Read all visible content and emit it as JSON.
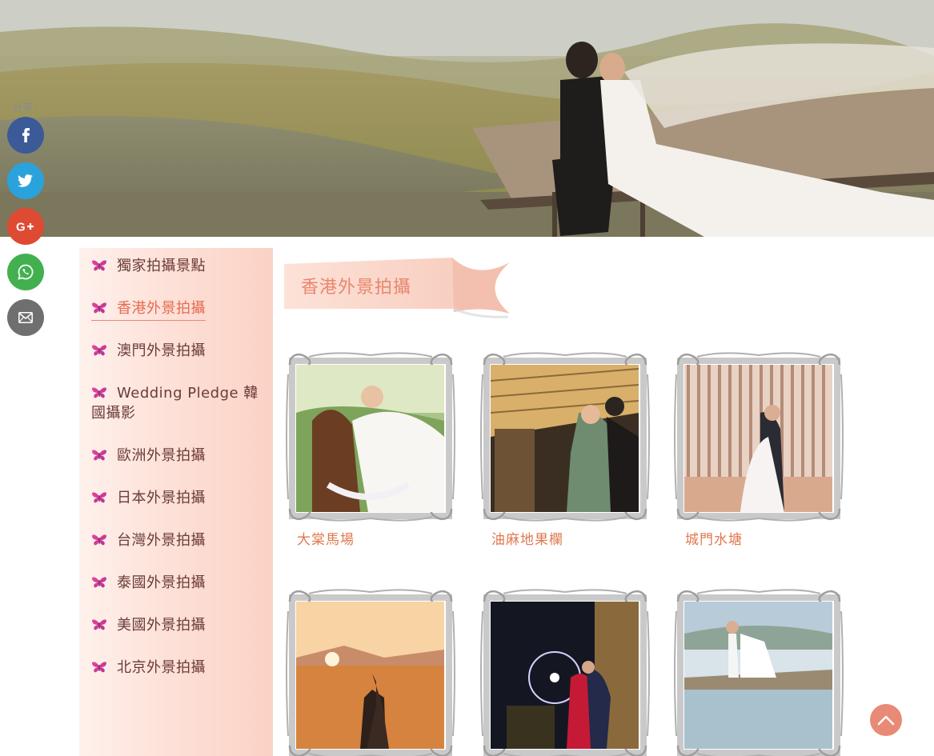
{
  "share": {
    "label": "分享：",
    "buttons": [
      {
        "name": "facebook",
        "icon": "facebook-icon",
        "color": "#3b5a98"
      },
      {
        "name": "twitter",
        "icon": "twitter-icon",
        "color": "#2aa3dc"
      },
      {
        "name": "google-plus",
        "icon": "google-plus-icon",
        "color": "#df4a32"
      },
      {
        "name": "whatsapp",
        "icon": "whatsapp-icon",
        "color": "#43b04f"
      },
      {
        "name": "email",
        "icon": "email-icon",
        "color": "#6f6f6f"
      }
    ]
  },
  "sidebar": {
    "items": [
      {
        "label": "獨家拍攝景點"
      },
      {
        "label": "香港外景拍攝",
        "active": true
      },
      {
        "label": "澳門外景拍攝"
      },
      {
        "label": "Wedding Pledge 韓國攝影"
      },
      {
        "label": "歐洲外景拍攝"
      },
      {
        "label": "日本外景拍攝"
      },
      {
        "label": "台灣外景拍攝"
      },
      {
        "label": "泰國外景拍攝"
      },
      {
        "label": "美國外景拍攝"
      },
      {
        "label": "北京外景拍攝"
      }
    ]
  },
  "section": {
    "title": "香港外景拍攝"
  },
  "gallery": [
    {
      "title": "大棠馬場"
    },
    {
      "title": "油麻地果欄"
    },
    {
      "title": "城門水塘"
    },
    {
      "title": ""
    },
    {
      "title": ""
    },
    {
      "title": ""
    }
  ],
  "colors": {
    "accent": "#e8876e",
    "sidebar_text": "#6b3b38",
    "active_text": "#e86a52",
    "card_title": "#e0784f",
    "to_top": "#e98a76"
  }
}
